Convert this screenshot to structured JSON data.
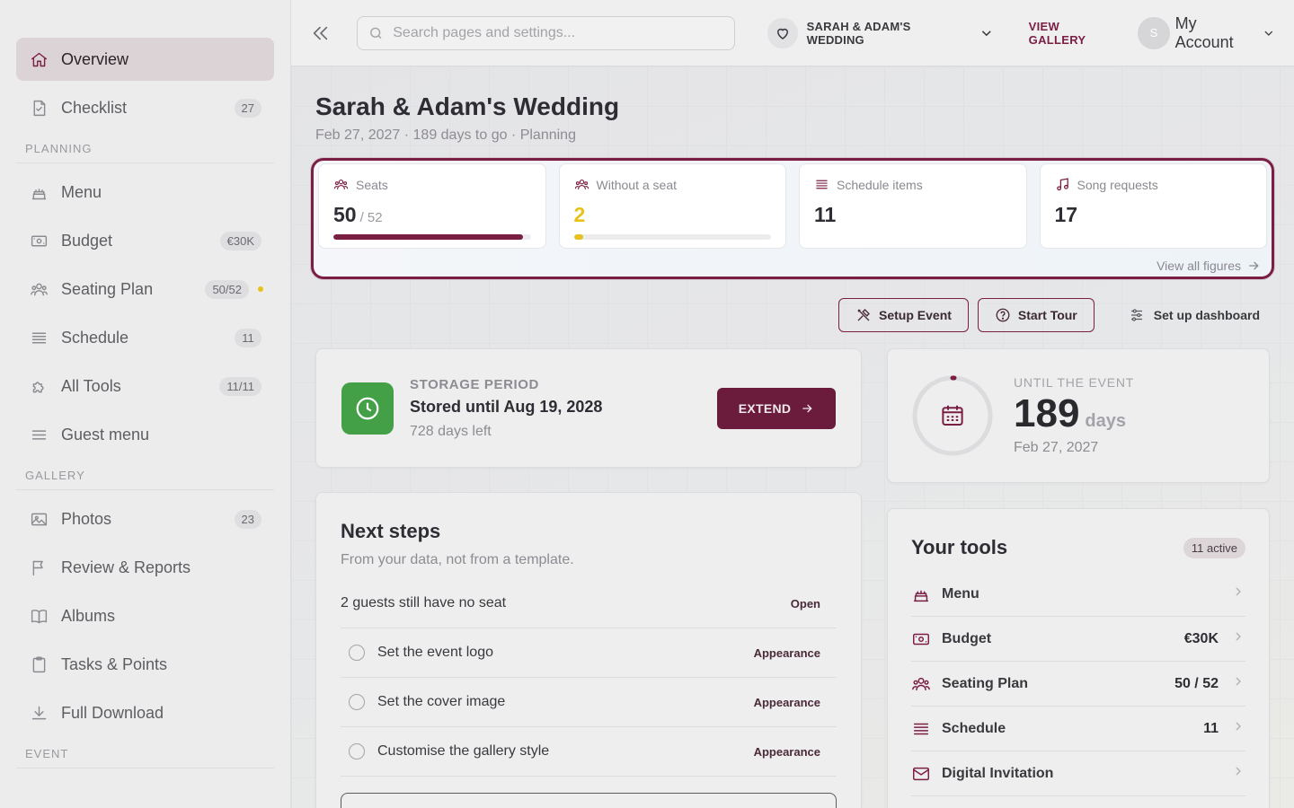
{
  "sidebar": {
    "items_top": [
      {
        "label": "Overview",
        "icon": "home-icon",
        "active": true
      },
      {
        "label": "Checklist",
        "icon": "checklist-icon",
        "badge": "27"
      }
    ],
    "sections": [
      {
        "title": "PLANNING",
        "items": [
          {
            "label": "Menu",
            "icon": "cake-icon"
          },
          {
            "label": "Budget",
            "icon": "money-icon",
            "badge": "€30K"
          },
          {
            "label": "Seating Plan",
            "icon": "people-icon",
            "badge": "50/52",
            "dot": true
          },
          {
            "label": "Schedule",
            "icon": "list-icon",
            "badge": "11"
          },
          {
            "label": "All Tools",
            "icon": "puzzle-icon",
            "badge": "11/11"
          },
          {
            "label": "Guest menu",
            "icon": "menu-lines-icon"
          }
        ]
      },
      {
        "title": "GALLERY",
        "items": [
          {
            "label": "Photos",
            "icon": "image-icon",
            "badge": "23"
          },
          {
            "label": "Review & Reports",
            "icon": "flag-icon"
          },
          {
            "label": "Albums",
            "icon": "book-icon"
          },
          {
            "label": "Tasks & Points",
            "icon": "clipboard-icon"
          },
          {
            "label": "Full Download",
            "icon": "download-icon"
          }
        ]
      },
      {
        "title": "EVENT",
        "items": []
      }
    ]
  },
  "topbar": {
    "search_placeholder": "Search pages and settings...",
    "event_name": "SARAH & ADAM'S WEDDING",
    "view_gallery": "VIEW GALLERY",
    "avatar_initial": "S",
    "account_label": "My Account"
  },
  "header": {
    "title": "Sarah & Adam's Wedding",
    "subtitle": "Feb 27, 2027 · 189 days to go · Planning"
  },
  "stats": [
    {
      "label": "Seats",
      "value": "50",
      "of": "/ 52",
      "progress": 0.96,
      "bar": "accent"
    },
    {
      "label": "Without a seat",
      "value": "2",
      "progress": 0.04,
      "bar": "warn",
      "warn": true
    },
    {
      "label": "Schedule items",
      "value": "11"
    },
    {
      "label": "Song requests",
      "value": "17"
    }
  ],
  "view_all_figures": "View all figures",
  "actions": {
    "setup_event": "Setup Event",
    "start_tour": "Start Tour",
    "setup_dashboard": "Set up dashboard"
  },
  "storage": {
    "kicker": "STORAGE PERIOD",
    "headline": "Stored until Aug 19, 2028",
    "sub": "728 days left",
    "button": "EXTEND"
  },
  "countdown": {
    "kicker": "UNTIL THE EVENT",
    "number": "189",
    "unit": "days",
    "date": "Feb 27, 2027"
  },
  "next_steps": {
    "title": "Next steps",
    "subtitle": "From your data, not from a template.",
    "rows": [
      {
        "label": "2 guests still have no seat",
        "action": "Open",
        "checkbox": false
      },
      {
        "label": "Set the event logo",
        "action": "Appearance",
        "checkbox": true
      },
      {
        "label": "Set the cover image",
        "action": "Appearance",
        "checkbox": true
      },
      {
        "label": "Customise the gallery style",
        "action": "Appearance",
        "checkbox": true
      }
    ]
  },
  "tools": {
    "title": "Your tools",
    "badge": "11 active",
    "rows": [
      {
        "label": "Menu",
        "value": "",
        "icon": "cake-icon"
      },
      {
        "label": "Budget",
        "value": "€30K",
        "icon": "money-icon"
      },
      {
        "label": "Seating Plan",
        "value": "50 / 52",
        "icon": "people-icon"
      },
      {
        "label": "Schedule",
        "value": "11",
        "icon": "list-icon"
      },
      {
        "label": "Digital Invitation",
        "value": "",
        "icon": "mail-icon"
      }
    ]
  },
  "colors": {
    "accent": "#7a1e44",
    "warn": "#e6c21b",
    "success": "#43a047"
  }
}
